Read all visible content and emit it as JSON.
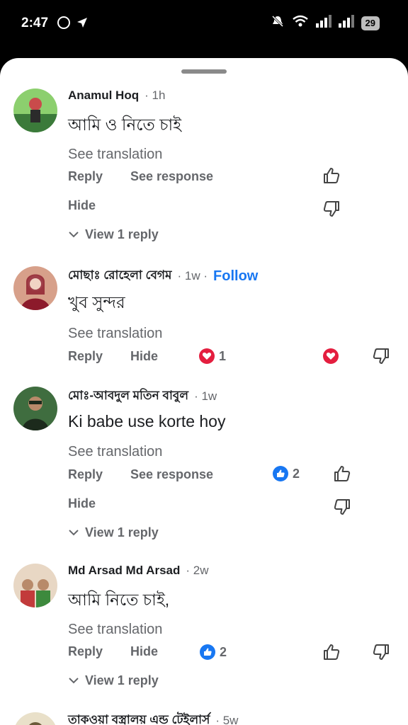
{
  "status_bar": {
    "time": "2:47",
    "battery": "29",
    "icons": [
      "whatsapp-icon",
      "messenger-icon",
      "mute-icon",
      "wifi-icon",
      "signal-icon",
      "signal-icon"
    ]
  },
  "comments": [
    {
      "name": "Anamul Hoq",
      "time": "1h",
      "text": "আমি ও নিতে চাই",
      "see_translation": "See translation",
      "reply_label": "Reply",
      "second_action": "See response",
      "hide_label": "Hide",
      "view_replies": "View 1 reply",
      "avatar_colors": [
        "#8ccf6e",
        "#3b7a3a",
        "#c94b4b"
      ]
    },
    {
      "name": "মোছাঃ রোহেলা বেগম",
      "time": "1w",
      "follow": "Follow",
      "text": "খুব সুন্দর",
      "see_translation": "See translation",
      "reply_label": "Reply",
      "hide_label": "Hide",
      "reaction_count": "1",
      "reaction_type": "love",
      "avatar_colors": [
        "#d7a08a",
        "#8c1a2b",
        "#f1d3c4"
      ]
    },
    {
      "name": "মোঃ-আবদুল মতিন বাবুল",
      "time": "1w",
      "text": "Ki babe use korte hoy",
      "see_translation": "See translation",
      "reply_label": "Reply",
      "second_action": "See response",
      "hide_label": "Hide",
      "reaction_count": "2",
      "reaction_type": "like",
      "view_replies": "View 1 reply",
      "avatar_colors": [
        "#3f6d3f",
        "#1c2a1c",
        "#b88a6a"
      ]
    },
    {
      "name": "Md Arsad Md Arsad",
      "time": "2w",
      "text": "আমি নিতে চাই,",
      "see_translation": "See translation",
      "reply_label": "Reply",
      "hide_label": "Hide",
      "reaction_count": "2",
      "reaction_type": "like",
      "view_replies": "View 1 reply",
      "avatar_colors": [
        "#e8d7c4",
        "#c23b3b",
        "#3d8a3d"
      ]
    },
    {
      "name": "তাকওয়া বস্ত্রালয় এন্ড টেইলার্স",
      "time": "5w",
      "avatar_colors": [
        "#e9e0c9",
        "#6b5b3a",
        "#ffffff"
      ]
    }
  ],
  "colors": {
    "like_blue": "#1877f2",
    "love_red": "#e41e3f",
    "secondary_text": "#65676b"
  }
}
